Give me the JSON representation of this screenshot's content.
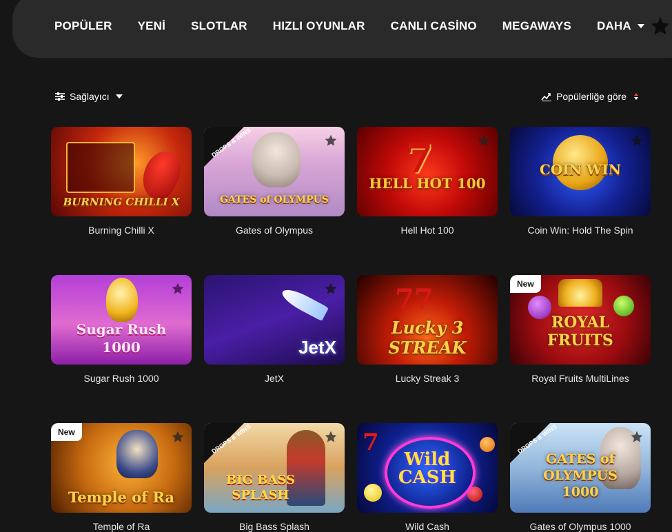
{
  "nav": {
    "items": [
      "POPÜLER",
      "YENİ",
      "SLOTLAR",
      "HIZLI OYUNLAR",
      "CANLI CASİNO",
      "MEGAWAYS",
      "DAHA"
    ]
  },
  "toolbar": {
    "filter_label": "Sağlayıcı",
    "sort_label": "Popülerliğe göre"
  },
  "badges": {
    "new": "New",
    "drops_wins": "DROPS & WINS"
  },
  "games": [
    {
      "title": "Burning Chilli X",
      "logo": "BURNING CHILLI X"
    },
    {
      "title": "Gates of Olympus",
      "logo": "GATES of OLYMPUS"
    },
    {
      "title": "Hell Hot 100",
      "logo": "HELL HOT 100"
    },
    {
      "title": "Coin Win: Hold The Spin",
      "logo": "COIN WIN"
    },
    {
      "title": "Sugar Rush 1000",
      "logo": "Sugar Rush 1000"
    },
    {
      "title": "JetX",
      "logo": "JetX"
    },
    {
      "title": "Lucky Streak 3",
      "logo": "Lucky 3 STREAK"
    },
    {
      "title": "Royal Fruits MultiLines",
      "logo": "ROYAL FRUITS"
    },
    {
      "title": "Temple of Ra",
      "logo": "Temple of Ra"
    },
    {
      "title": "Big Bass Splash",
      "logo": "BIG BASS SPLASH"
    },
    {
      "title": "Wild Cash",
      "logo": "Wild CASH"
    },
    {
      "title": "Gates of Olympus 1000",
      "logo": "GATES of OLYMPUS 1000"
    }
  ],
  "colors": {
    "background": "#161616",
    "nav_bg": "#2a2a2a",
    "badge_bg": "#ffffff"
  }
}
